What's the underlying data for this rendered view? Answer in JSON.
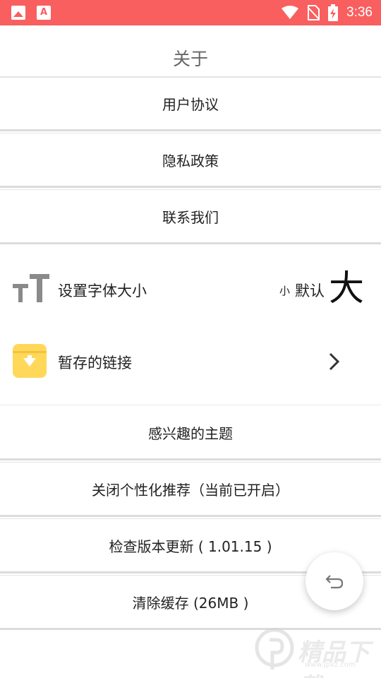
{
  "status_bar": {
    "time": "3:36",
    "icons": [
      "image-notification-icon",
      "app-notification-icon",
      "wifi-icon",
      "no-sim-icon",
      "battery-charging-icon"
    ],
    "app_icon_glyph": "A"
  },
  "header": {
    "title": "关于"
  },
  "menu": {
    "user_agreement": "用户协议",
    "privacy_policy": "隐私政策",
    "contact_us": "联系我们",
    "interest_topics": "感兴趣的主题",
    "personalization": "关闭个性化推荐（当前已开启）",
    "check_update": "检查版本更新 ( 1.01.15 )",
    "clear_cache": "清除缓存 (26MB )"
  },
  "font_size": {
    "label": "设置字体大小",
    "options": {
      "small": "小",
      "default": "默认",
      "large": "大"
    }
  },
  "saved_links": {
    "label": "暂存的链接"
  },
  "watermark": {
    "text": "精品下载",
    "sub": "www.jpxz.com"
  },
  "colors": {
    "status_bar": "#f95f5f",
    "folder_icon": "#ffd85a",
    "divider": "#dcdcdc"
  }
}
